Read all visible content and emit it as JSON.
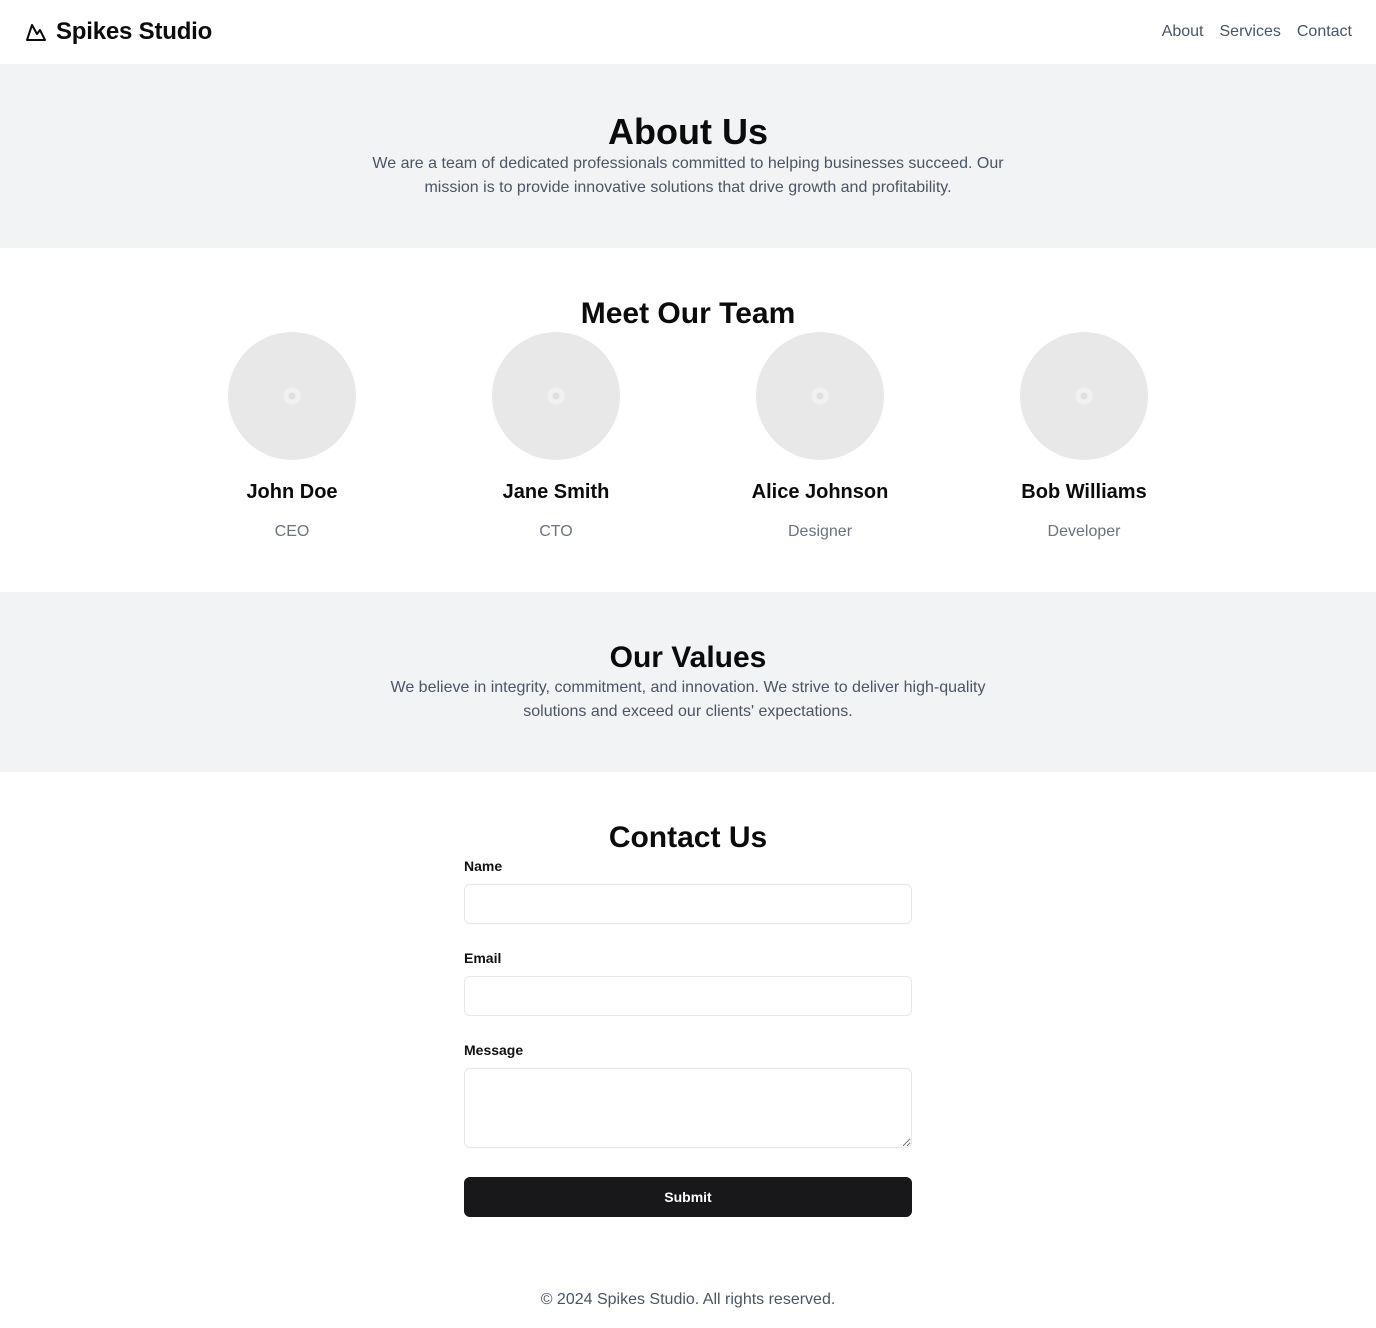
{
  "header": {
    "brand": "Spikes Studio",
    "logo_icon": "mountain-icon",
    "nav": [
      {
        "label": "About"
      },
      {
        "label": "Services"
      },
      {
        "label": "Contact"
      }
    ]
  },
  "about": {
    "title": "About Us",
    "text": "We are a team of dedicated professionals committed to helping businesses succeed. Our mission is to provide innovative solutions that drive growth and profitability."
  },
  "team": {
    "title": "Meet Our Team",
    "members": [
      {
        "name": "John Doe",
        "role": "CEO"
      },
      {
        "name": "Jane Smith",
        "role": "CTO"
      },
      {
        "name": "Alice Johnson",
        "role": "Designer"
      },
      {
        "name": "Bob Williams",
        "role": "Developer"
      }
    ]
  },
  "values": {
    "title": "Our Values",
    "text": "We believe in integrity, commitment, and innovation. We strive to deliver high-quality solutions and exceed our clients' expectations."
  },
  "contact": {
    "title": "Contact Us",
    "name_label": "Name",
    "name_value": "",
    "email_label": "Email",
    "email_value": "",
    "message_label": "Message",
    "message_value": "",
    "submit_label": "Submit"
  },
  "footer": {
    "text": "© 2024 Spikes Studio. All rights reserved."
  },
  "colors": {
    "section_bg": "#f2f3f5",
    "button_bg": "#18181b",
    "muted_text": "#4b5563"
  }
}
